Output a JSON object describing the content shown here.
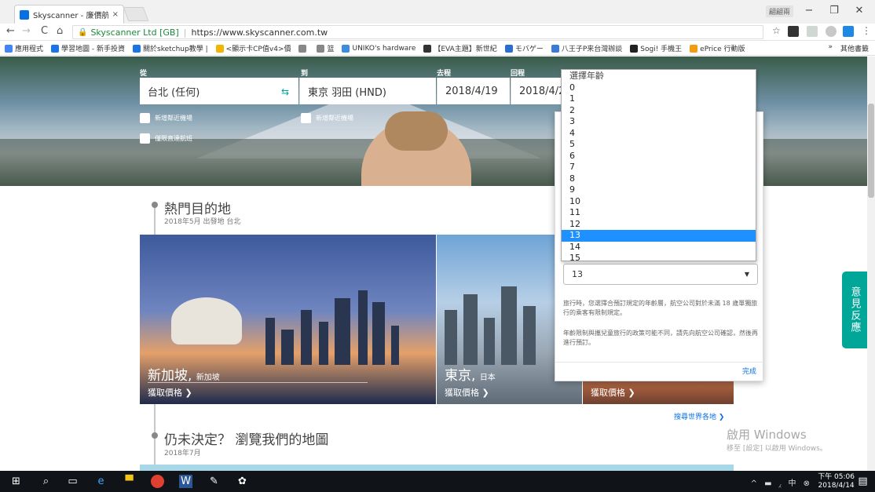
{
  "browser": {
    "tab_title": "Skyscanner - 廉價航空",
    "tab_close": "×",
    "user_badge": "翩翩兩",
    "win_min": "−",
    "win_max": "❐",
    "win_close": "✕",
    "nav_back": "←",
    "nav_forward": "→",
    "nav_reload": "C",
    "nav_home": "⌂",
    "site_owner": "Skyscanner Ltd [GB]",
    "url_sep": "|",
    "url": "https://www.skyscanner.com.tw",
    "star": "☆",
    "menu": "⋮",
    "bookmarks": [
      {
        "label": "應用程式",
        "color": "#4285f4"
      },
      {
        "label": "學習地圖 - 新手投資",
        "color": "#1a73e8"
      },
      {
        "label": "關於sketchup教學 |",
        "color": "#1a73e8"
      },
      {
        "label": "<顯示卡CP值v4>價",
        "color": "#f4b400"
      },
      {
        "label": "",
        "color": "#888888"
      },
      {
        "label": "篮",
        "color": "#888888"
      },
      {
        "label": "UNIKO's hardware",
        "color": "#3c8dde"
      },
      {
        "label": "【EVA主題】新世紀",
        "color": "#333333"
      },
      {
        "label": "モバゲー",
        "color": "#2a6fcf"
      },
      {
        "label": "八王子P来台灣辦談",
        "color": "#3a7bd5"
      },
      {
        "label": "Sogi! 手機王",
        "color": "#222222"
      },
      {
        "label": "ePrice 行動版",
        "color": "#f39c12"
      }
    ],
    "bookmarks_more": "»",
    "bookmarks_other": "其他書籤"
  },
  "search": {
    "from_label": "從",
    "to_label": "到",
    "depart_label": "去程",
    "return_label": "回程",
    "from_value": "台北 (任何)",
    "swap_icon": "⇆",
    "to_value": "東京 羽田 (HND)",
    "depart_value": "2018/4/19",
    "return_value": "2018/4/20",
    "nearby_from": "新增鄰近機場",
    "nearby_to": "新增鄰近機場",
    "direct_only": "僅限直達航班"
  },
  "sections": {
    "popular_title": "熱門目的地",
    "popular_sub": "2018年5月  出發地 台北",
    "map_title": "仍未決定？ 瀏覽我們的地圖",
    "map_sub": "2018年7月"
  },
  "cards": [
    {
      "name": "新加坡,",
      "country": "新加坡",
      "price": "獲取價格 ❯"
    },
    {
      "name": "東京,",
      "country": "日本",
      "price": "獲取價格 ❯"
    },
    {
      "name": "",
      "country": "",
      "price": "獲取價格 ❯"
    }
  ],
  "explore_link": "搜尋世界各地 ❯",
  "feedback": "意見反應",
  "popup": {
    "select_value": "13",
    "note1": "旅行時，您選擇合預訂規定的年齡層，航空公司對於未滿 18 歲單獨旅行的乘客有限制規定。",
    "note2": "年齡限制與攜兒童旅行的政策可能不同，請先向航空公司確認，然後再進行預訂。",
    "done": "完成"
  },
  "dropdown": {
    "header": "選擇年齡",
    "options": [
      "0",
      "1",
      "2",
      "3",
      "4",
      "5",
      "6",
      "7",
      "8",
      "9",
      "10",
      "11",
      "12",
      "13",
      "14",
      "15"
    ],
    "selected": "13"
  },
  "watermark": {
    "line1": "啟用 Windows",
    "line2": "移至 [設定] 以啟用 Windows。"
  },
  "taskbar": {
    "time": "下午 05:06",
    "date": "2018/4/14",
    "tray_icons": "^ ▬ ⁁ 中 ⊗"
  }
}
